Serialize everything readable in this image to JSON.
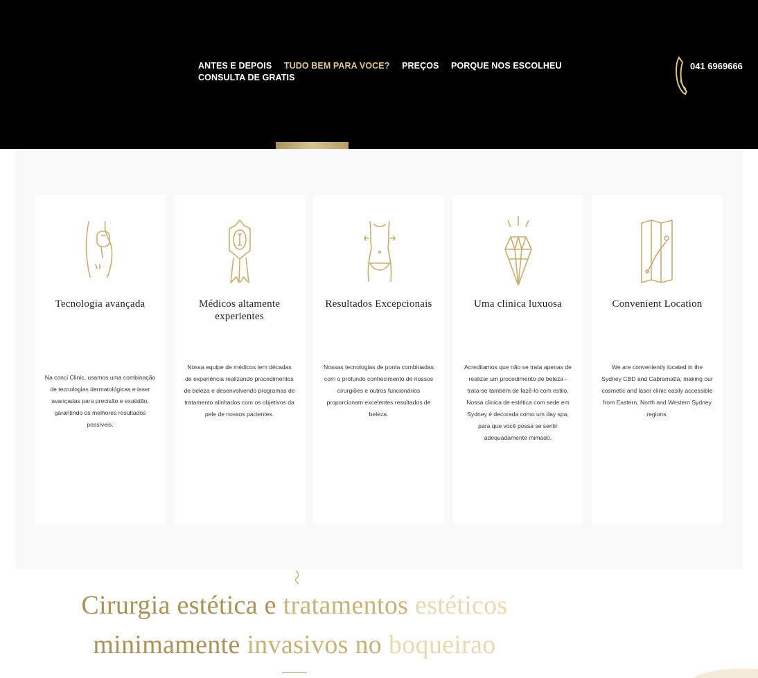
{
  "header": {
    "nav": [
      {
        "label": "ANTES E DEPOIS",
        "active": false
      },
      {
        "label": "TUDO BEM PARA VOCE?",
        "active": true
      },
      {
        "label": "PREÇOS",
        "active": false
      },
      {
        "label": "PORQUE NOS ESCOLHEU",
        "active": false
      },
      {
        "label": "CONSULTA DE GRATIS",
        "active": false
      }
    ],
    "phone": "041 6969666",
    "phone_icon": "phone-icon",
    "accent_color": "#e2c98f"
  },
  "features": [
    {
      "icon": "body-laser-icon",
      "title": "Tecnologia avançada",
      "text": "Na conci Clinic, usamos uma combinação de tecnologias dermatológicas e laser avançadas para precisão e exatidão, garantindo os melhores resultados possíveis."
    },
    {
      "icon": "award-ribbon-icon",
      "title": "Médicos altamente experientes",
      "text": "Nossa equipe de médicos tem décadas de experiência realizando procedimentos de beleza e desenvolvendo programas de tratamento alinhados com os objetivos da pele de nossos pacientes."
    },
    {
      "icon": "body-contour-icon",
      "title": "Resultados Excepcionais",
      "text": "Nossas tecnologias de ponta combinadas com o profundo conhecimento de nossos cirurgiões e outros funcionários proporcionam excelentes resultados de beleza."
    },
    {
      "icon": "diamond-icon",
      "title": "Uma clinica luxuosa",
      "text": "Acreditamos que não se trata apenas de realizar um procedimento de beleza - trata-se também de fazê-lo com estilo. Nossa clinica de estética com sede em Sydney é decorada como um day spa, para que você possa se sentir adequadamente mimado."
    },
    {
      "icon": "map-icon",
      "title": "Convenient Location",
      "text": "We are conveniently located in the Sydney CBD and Cabramatta, making our cosmetic and laser clinic easily accessible from Eastern, North and Western Sydney regions."
    }
  ],
  "headline": {
    "line1": {
      "a": "Cirurgia estética e ",
      "b": "tratamentos ",
      "c": "estéticos"
    },
    "line2": {
      "a": "minimamente ",
      "b": "invasivos no ",
      "c": "boqueirao"
    }
  },
  "colors": {
    "gold_dark": "#a99157",
    "gold_mid": "#c7b27a",
    "gold_light": "#e8d9b3"
  }
}
